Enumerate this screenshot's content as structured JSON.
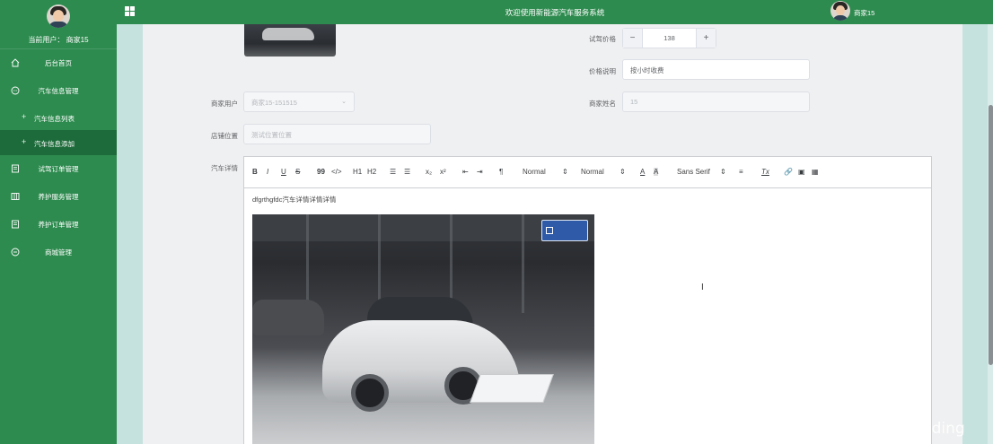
{
  "sidebar": {
    "current_user": "当前用户：  商家15",
    "items": [
      {
        "label": "后台首页",
        "icon": "home-icon"
      },
      {
        "label": "汽车信息管理",
        "icon": "chat-icon"
      },
      {
        "label": "汽车信息列表",
        "sub": true
      },
      {
        "label": "汽车信息添加",
        "sub": true,
        "active": true
      },
      {
        "label": "试驾订单管理",
        "icon": "document-icon"
      },
      {
        "label": "养护服务管理",
        "icon": "columns-icon"
      },
      {
        "label": "养护订单管理",
        "icon": "document-icon"
      },
      {
        "label": "商城管理",
        "icon": "chat-icon"
      }
    ]
  },
  "topbar": {
    "title": "欢迎使用新能源汽车服务系统",
    "username": "商家15"
  },
  "form": {
    "price_label": "试驾价格",
    "price_minus": "−",
    "price_value": "138",
    "price_plus": "+",
    "price_desc_label": "价格说明",
    "price_desc_value": "按小时收费",
    "merchant_user_label": "商家用户",
    "merchant_user_value": "商家15-151515",
    "merchant_name_label": "商家姓名",
    "merchant_name_value": "15",
    "store_location_label": "店铺位置",
    "store_location_placeholder": "测试位置位置",
    "details_label": "汽车详情"
  },
  "editor": {
    "toolbar": {
      "bold": "B",
      "italic": "I",
      "underline": "U",
      "strike": "S",
      "quote": "99",
      "code": "</>",
      "h1": "H1",
      "h2": "H2",
      "ol": "☰",
      "ul": "☰",
      "sub": "x₂",
      "sup": "x²",
      "outdent": "⇤",
      "indent": "⇥",
      "direction": "¶",
      "size": "Normal",
      "header": "Normal",
      "color": "A",
      "background": "A",
      "font": "Sans Serif",
      "align": "≡",
      "clean": "Tx",
      "link": "🔗",
      "image": "▣",
      "video": "▦"
    },
    "body_text": "dfgrthgfdc汽车详情详情详情"
  },
  "watermark": "CSDN @花椒coding"
}
